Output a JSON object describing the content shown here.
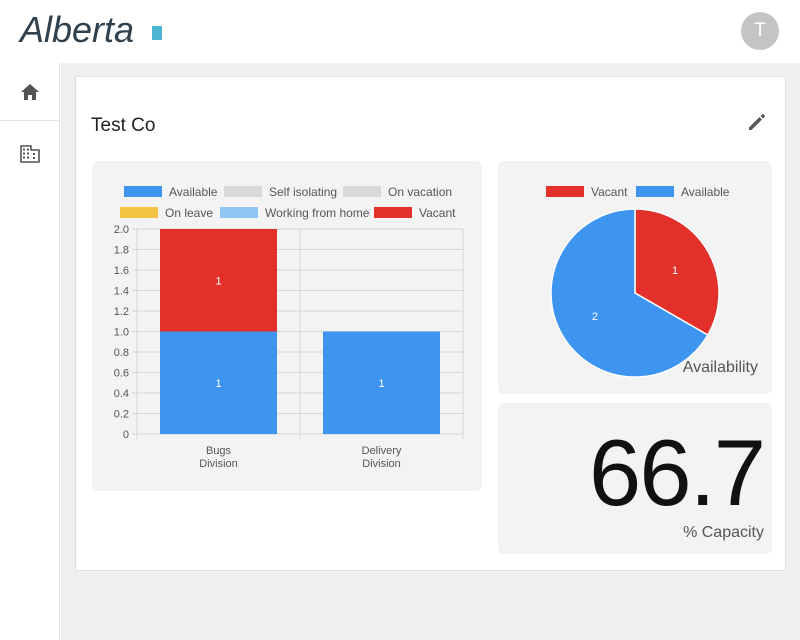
{
  "header": {
    "logo_text": "Alberta",
    "avatar_initial": "T"
  },
  "sidebar": {
    "items": [
      {
        "name": "home",
        "icon": "home-icon"
      },
      {
        "name": "organizations",
        "icon": "building-icon"
      }
    ]
  },
  "company": {
    "name": "Test Co"
  },
  "colors": {
    "available": "#3d95ef",
    "self_isolating": "#d9d9d9",
    "on_vacation": "#d9d9d9",
    "on_leave": "#f5c342",
    "working_from_home": "#90c6f4",
    "vacant": "#e3302a"
  },
  "chart_data": [
    {
      "type": "bar",
      "stacked": true,
      "categories": [
        [
          "Bugs",
          "Division"
        ],
        [
          "Delivery",
          "Division"
        ]
      ],
      "legend": [
        "Available",
        "Self isolating",
        "On vacation",
        "On leave",
        "Working from home",
        "Vacant"
      ],
      "legend_position": "top",
      "series": [
        {
          "name": "Available",
          "color": "#3d95ef",
          "values": [
            1,
            1
          ]
        },
        {
          "name": "Self isolating",
          "color": "#d9d9d9",
          "values": [
            0,
            0
          ]
        },
        {
          "name": "On vacation",
          "color": "#d9d9d9",
          "values": [
            0,
            0
          ]
        },
        {
          "name": "On leave",
          "color": "#f5c342",
          "values": [
            0,
            0
          ]
        },
        {
          "name": "Working from home",
          "color": "#90c6f4",
          "values": [
            0,
            0
          ]
        },
        {
          "name": "Vacant",
          "color": "#e3302a",
          "values": [
            1,
            0
          ]
        }
      ],
      "ylim": [
        0,
        2.0
      ],
      "yticks": [
        "2.0",
        "1.8",
        "1.6",
        "1.4",
        "1.2",
        "1.0",
        "0.8",
        "0.6",
        "0.4",
        "0.2",
        "0"
      ],
      "grid": true
    },
    {
      "type": "pie",
      "title": "Availability",
      "legend": [
        "Vacant",
        "Available"
      ],
      "legend_position": "top",
      "slices": [
        {
          "name": "Vacant",
          "color": "#e3302a",
          "value": 1
        },
        {
          "name": "Available",
          "color": "#3d95ef",
          "value": 2
        }
      ]
    }
  ],
  "capacity": {
    "value": "66.7",
    "label": "% Capacity"
  }
}
